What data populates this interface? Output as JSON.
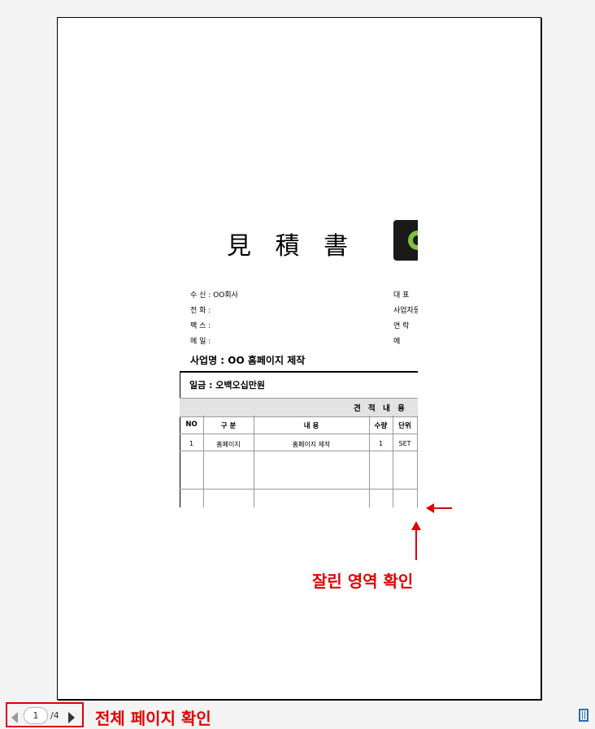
{
  "document": {
    "title": "見 積 書",
    "recipient": {
      "to": "수  신 : OO회사",
      "tel": "전  화 :",
      "fax": "팩  스 :",
      "mail": "메  일 :"
    },
    "sender": {
      "rep": "대     표",
      "biz_no": "사업자등",
      "contact": "연     락",
      "mail": "메"
    },
    "project": "사업명 : OO 홈페이지 제작",
    "amount": "일금 : 오백오십만원",
    "estimate_header": "견 적 내 용",
    "table": {
      "headers": [
        "NO",
        "구    분",
        "내            용",
        "수량",
        "단위"
      ],
      "rows": [
        [
          "1",
          "홈페이지",
          "홈페이지 제작",
          "1",
          "SET"
        ]
      ]
    }
  },
  "annotations": {
    "cropped_area": "잘린 영역 확인",
    "all_pages": "전체 페이지 확인",
    "color": "#e00000"
  },
  "toolbar": {
    "current_page": "1",
    "total_pages": "/4",
    "prev_icon": "triangle-left-icon",
    "next_icon": "triangle-right-icon",
    "fit_icon": "page-fit-icon"
  }
}
